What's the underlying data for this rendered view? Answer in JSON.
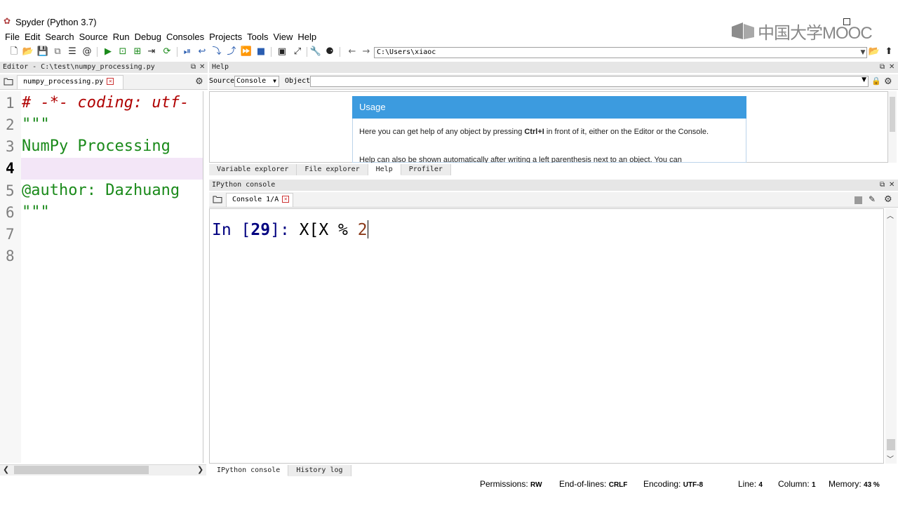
{
  "window": {
    "title": "Spyder (Python 3.7)"
  },
  "watermark": {
    "text": "中国大学MOOC"
  },
  "menu": [
    "File",
    "Edit",
    "Search",
    "Source",
    "Run",
    "Debug",
    "Consoles",
    "Projects",
    "Tools",
    "View",
    "Help"
  ],
  "toolbar": {
    "path": "C:\\Users\\xiaoc"
  },
  "editor": {
    "title": "Editor - C:\\test\\numpy_processing.py",
    "tab": "numpy_processing.py",
    "lines": [
      {
        "n": "1",
        "text": "# -*- coding: utf-"
      },
      {
        "n": "2",
        "text": "\"\"\""
      },
      {
        "n": "3",
        "text": "NumPy Processing"
      },
      {
        "n": "4",
        "text": ""
      },
      {
        "n": "5",
        "text": "@author: Dazhuang"
      },
      {
        "n": "6",
        "text": "\"\"\""
      },
      {
        "n": "7",
        "text": ""
      },
      {
        "n": "8",
        "text": ""
      }
    ],
    "current_line": 4
  },
  "help": {
    "title": "Help",
    "source_label": "Source",
    "source_value": "Console",
    "object_label": "Object",
    "usage_title": "Usage",
    "usage_line1_pre": "Here you can get help of any object by pressing ",
    "usage_line1_key": "Ctrl+I",
    "usage_line1_post": " in front of it, either on the Editor or the Console.",
    "usage_line2": "Help can also be shown automatically after writing a left parenthesis next to an object. You can",
    "tabs": [
      "Variable explorer",
      "File explorer",
      "Help",
      "Profiler"
    ],
    "active_tab": "Help"
  },
  "console": {
    "title": "IPython console",
    "tab": "Console 1/A",
    "prompt_in": "In [",
    "prompt_num": "29",
    "prompt_close": "]: ",
    "code": "X[X % ",
    "code_num": "2",
    "tabs": [
      "IPython console",
      "History log"
    ],
    "active_tab": "IPython console"
  },
  "status": {
    "permissions_label": "Permissions:",
    "permissions": "RW",
    "eol_label": "End-of-lines:",
    "eol": "CRLF",
    "encoding_label": "Encoding:",
    "encoding": "UTF-8",
    "line_label": "Line:",
    "line": "4",
    "column_label": "Column:",
    "column": "1",
    "memory_label": "Memory:",
    "memory": "43 %"
  }
}
